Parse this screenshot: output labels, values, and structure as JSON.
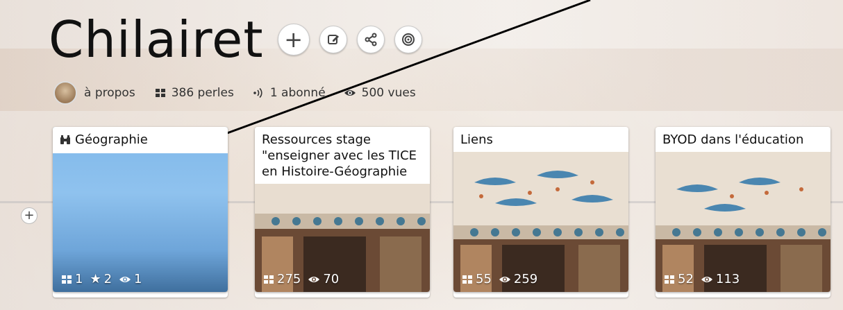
{
  "header": {
    "title": "Chilairet",
    "buttons": [
      {
        "name": "add-button",
        "icon": "plus-icon"
      },
      {
        "name": "edit-button",
        "icon": "edit-icon"
      },
      {
        "name": "share-button",
        "icon": "share-icon"
      },
      {
        "name": "follow-button",
        "icon": "target-icon"
      }
    ]
  },
  "stats": {
    "about": "à propos",
    "pearls": "386 perles",
    "subscribers": "1 abonné",
    "views": "500 vues"
  },
  "cards": [
    {
      "title": "Géographie",
      "title_icon": "binoculars-icon",
      "pearls": "1",
      "stars": "2",
      "views": "1"
    },
    {
      "title": "Ressources stage \"enseigner avec les TICE en Histoire-Géographie",
      "pearls": "275",
      "views": "70"
    },
    {
      "title": "Liens",
      "pearls": "55",
      "views": "259"
    },
    {
      "title": "BYOD dans l'éducation",
      "pearls": "52",
      "views": "113"
    }
  ],
  "colors": {
    "card_blue_top": "#7fb6e8",
    "card_blue_bottom": "#5a93c9",
    "arrow": "#000000"
  }
}
